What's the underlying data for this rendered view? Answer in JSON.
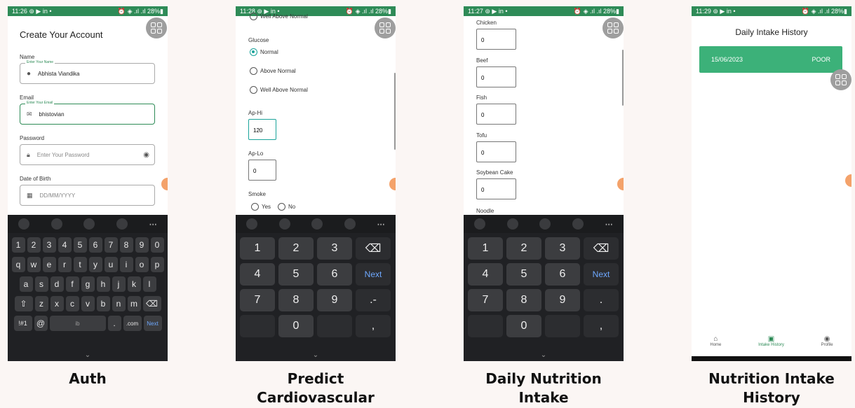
{
  "screens": {
    "auth": {
      "status": {
        "time": "11:26",
        "icons": "⊚ ▶ in •",
        "right": "⏰ ◈ .ıl .ıl 28%▮"
      },
      "title": "Create Your Account",
      "name_label": "Name",
      "name_float": "Enter Your Name",
      "name_value": "Abhista Viandika",
      "email_label": "Email",
      "email_float": "Enter Your Email",
      "email_value": "bhistovian",
      "password_label": "Password",
      "password_placeholder": "Enter Your Password",
      "dob_label": "Date of Birth",
      "dob_placeholder": "DD/MM/YYYY",
      "keyboard": {
        "numbers": [
          "1",
          "2",
          "3",
          "4",
          "5",
          "6",
          "7",
          "8",
          "9",
          "0"
        ],
        "row1": [
          "q",
          "w",
          "e",
          "r",
          "t",
          "y",
          "u",
          "i",
          "o",
          "p"
        ],
        "row2": [
          "a",
          "s",
          "d",
          "f",
          "g",
          "h",
          "j",
          "k",
          "l"
        ],
        "row3": [
          "z",
          "x",
          "c",
          "v",
          "b",
          "n",
          "m"
        ],
        "sym": "!#1",
        "at": "@",
        "space": "ib",
        "dot": ".",
        "com": ".com",
        "next": "Next"
      },
      "caption": "Auth"
    },
    "predict": {
      "status": {
        "time": "11:28",
        "icons": "⊚ ▶ in •",
        "right": "⏰ ◈ .ıl .ıl 28%▮"
      },
      "top_option": "Well Above Normal",
      "glucose_label": "Glucose",
      "glucose_options": [
        "Normal",
        "Above Normal",
        "Well Above Normal"
      ],
      "aphi_label": "Ap-Hi",
      "aphi_value": "120",
      "aplo_label": "Ap-Lo",
      "aplo_value": "0",
      "smoke_label": "Smoke",
      "smoke_yes": "Yes",
      "smoke_no": "No",
      "keys": [
        "1",
        "2",
        "3",
        "⌫",
        "4",
        "5",
        "6",
        "Next",
        "7",
        "8",
        "9",
        ".-",
        "",
        "0",
        "",
        ","
      ],
      "caption_line1": "Predict",
      "caption_line2": "Cardiovascular"
    },
    "nutrition": {
      "status": {
        "time": "11:27",
        "icons": "⊚ ▶ in •",
        "right": "⏰ ◈ .ıl .ıl 28%▮"
      },
      "items": [
        {
          "label": "Chicken",
          "value": "0"
        },
        {
          "label": "Beef",
          "value": "0"
        },
        {
          "label": "Fish",
          "value": "0"
        },
        {
          "label": "Tofu",
          "value": "0"
        },
        {
          "label": "Soybean Cake",
          "value": "0"
        }
      ],
      "cut_label": "Noodle",
      "keys": [
        "1",
        "2",
        "3",
        "⌫",
        "4",
        "5",
        "6",
        "Next",
        "7",
        "8",
        "9",
        ".",
        "",
        "0",
        "",
        ","
      ],
      "caption_line1": "Daily Nutrition",
      "caption_line2": "Intake"
    },
    "history": {
      "status": {
        "time": "11:29",
        "icons": "⊚ ▶ in •",
        "right": "⏰ ◈ .ıl .ıl 28%▮"
      },
      "title": "Daily Intake History",
      "card_date": "15/06/2023",
      "card_status": "POOR",
      "nav": [
        {
          "label": "Home",
          "icon": "home-icon"
        },
        {
          "label": "Intake History",
          "icon": "history-icon"
        },
        {
          "label": "Profile",
          "icon": "profile-icon"
        }
      ],
      "caption_line1": "Nutrition Intake",
      "caption_line2": "History"
    }
  },
  "colors": {
    "primary": "#2e8b57",
    "card": "#3cb179",
    "fab": "#9e9e9e",
    "accent": "#1aa39a"
  }
}
